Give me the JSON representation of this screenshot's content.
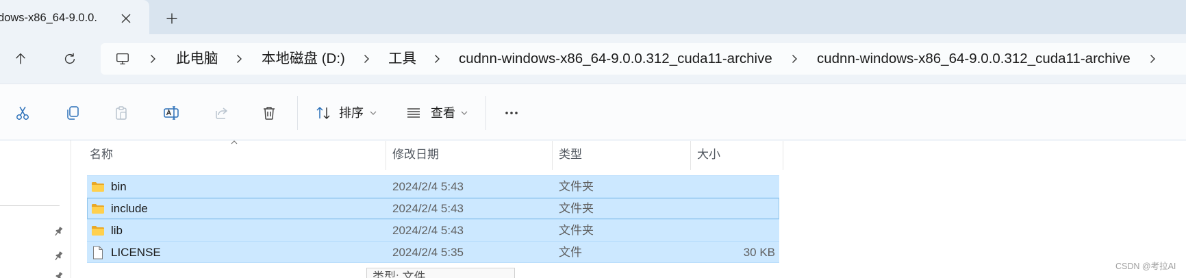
{
  "window": {
    "tab_title": "dows-x86_64-9.0.0.",
    "icons": {
      "close_tab": "close-icon",
      "new_tab": "plus-icon"
    }
  },
  "navigation": {
    "icons": {
      "up": "arrow-up-icon",
      "refresh": "refresh-icon"
    }
  },
  "address_bar": {
    "root_icon": "computer-icon",
    "separator_icon": "chevron-right-icon",
    "breadcrumbs": [
      "此电脑",
      "本地磁盘 (D:)",
      "工具",
      "cudnn-windows-x86_64-9.0.0.312_cuda11-archive",
      "cudnn-windows-x86_64-9.0.0.312_cuda11-archive"
    ]
  },
  "toolbar": {
    "actions": [
      {
        "icon": "scissors-icon",
        "enabled": true
      },
      {
        "icon": "copy-icon",
        "enabled": true
      },
      {
        "icon": "paste-icon",
        "enabled": false
      },
      {
        "icon": "rename-icon",
        "enabled": true
      },
      {
        "icon": "share-icon",
        "enabled": false
      },
      {
        "icon": "trash-icon",
        "enabled": true
      }
    ],
    "sort": {
      "label": "排序",
      "icon": "sort-icon"
    },
    "view": {
      "label": "查看",
      "icon": "view-list-icon"
    },
    "more_icon": "more-icon"
  },
  "file_list": {
    "columns": [
      "名称",
      "修改日期",
      "类型",
      "大小"
    ],
    "sort_column_index": 0,
    "focused_row_index": 1,
    "rows": [
      {
        "name": "bin",
        "modified": "2024/2/4 5:43",
        "type": "文件夹",
        "size": "",
        "icon": "folder-icon",
        "selected": true
      },
      {
        "name": "include",
        "modified": "2024/2/4 5:43",
        "type": "文件夹",
        "size": "",
        "icon": "folder-icon",
        "selected": true
      },
      {
        "name": "lib",
        "modified": "2024/2/4 5:43",
        "type": "文件夹",
        "size": "",
        "icon": "folder-icon",
        "selected": true
      },
      {
        "name": "LICENSE",
        "modified": "2024/2/4 5:35",
        "type": "文件",
        "size": "30 KB",
        "icon": "file-icon",
        "selected": true
      }
    ]
  },
  "tooltip": {
    "text": "类型: 文件"
  },
  "watermark": "CSDN @考拉AI",
  "colors": {
    "titlebar": "#d9e4ef",
    "address_row": "#eef3f8",
    "selection": "#cce8ff",
    "selection_border": "#8fc4ec",
    "accent": "#2a6fb8",
    "disabled_icon": "#b9c4cf"
  }
}
